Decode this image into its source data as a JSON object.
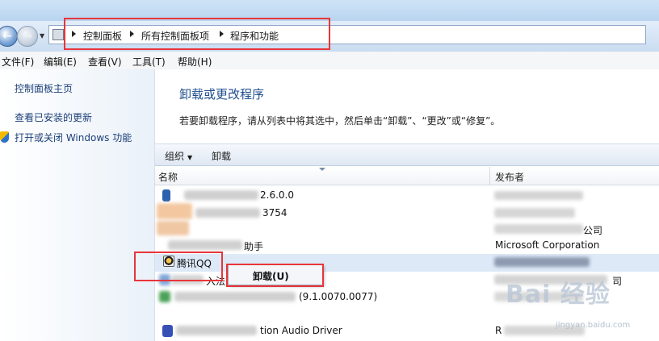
{
  "breadcrumb": [
    "控制面板",
    "所有控制面板项",
    "程序和功能"
  ],
  "menubar": [
    "文件(F)",
    "编辑(E)",
    "查看(V)",
    "工具(T)",
    "帮助(H)"
  ],
  "sidebar": {
    "links": [
      "控制面板主页",
      "查看已安装的更新",
      "打开或关闭 Windows 功能"
    ]
  },
  "main": {
    "title": "卸载或更改程序",
    "description": "若要卸载程序，请从列表中将其选中，然后单击“卸载”、“更改”或“修复”。"
  },
  "toolbar": {
    "organize_label": "组织",
    "organize_caret": "▼",
    "uninstall_label": "卸载"
  },
  "columns": {
    "name": "名称",
    "publisher": "发布者"
  },
  "rows": [
    {
      "name": "2.6.0.0",
      "publisher": ""
    },
    {
      "name": "3754",
      "publisher": ""
    },
    {
      "name": "",
      "publisher": "公司"
    },
    {
      "name": "助手",
      "publisher": "Microsoft Corporation"
    },
    {
      "name": "腾讯QQ",
      "publisher": ""
    },
    {
      "name": "入法",
      "publisher": "司"
    },
    {
      "name": "(9.1.0070.0077)",
      "publisher": ""
    },
    {
      "name": "tion Audio Driver",
      "publisher": "R"
    }
  ],
  "context_menu": {
    "uninstall": "卸载(U)"
  },
  "watermark": {
    "logo": "Bai 经验",
    "url": "jingyan.baidu.com"
  },
  "colors": {
    "highlight_border": "#e8353a",
    "link": "#1c3f78",
    "title": "#1f4d8f",
    "selection": "#dde9f7"
  }
}
